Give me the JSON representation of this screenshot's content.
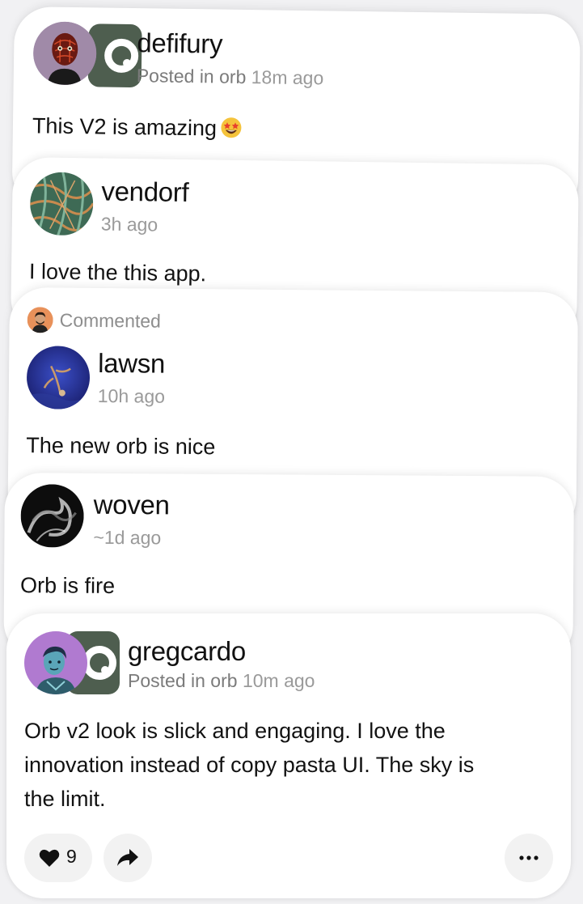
{
  "colors": {
    "card_bg": "#ffffff",
    "page_bg": "#f1f1f3",
    "orb_badge": "#4e5e4f",
    "meta_text": "#9a9a9a",
    "action_bg": "#f2f2f2"
  },
  "posts": [
    {
      "username": "defifury",
      "posted_in_prefix": "Posted in ",
      "community": "orb",
      "time": "18m ago",
      "text": "This V2 is amazing",
      "emoji": "star-struck-emoji",
      "avatar_icon": "avatar-defifury",
      "community_icon": "orb-community-icon"
    },
    {
      "username": "vendorf",
      "time": "3h ago",
      "text": "I love the this app.",
      "avatar_icon": "avatar-vendorf"
    },
    {
      "activity_label": "Commented",
      "username": "lawsn",
      "time": "10h ago",
      "text": "The new orb is nice",
      "avatar_icon": "avatar-lawsn"
    },
    {
      "username": "woven",
      "time": "~1d ago",
      "text": "Orb is fire",
      "avatar_icon": "avatar-woven"
    },
    {
      "username": "gregcardo",
      "posted_in_prefix": "Posted in ",
      "community": "orb",
      "time": "10m ago",
      "text_line1": "Orb v2 look is slick and engaging. I love the",
      "text_line2": "innovation instead of copy pasta UI. The sky is",
      "text_line3": "the limit.",
      "like_count": "9",
      "avatar_icon": "avatar-gregcardo",
      "community_icon": "orb-community-icon"
    }
  ],
  "icons": {
    "like": "heart-icon",
    "share": "share-arrow-icon",
    "more": "more-dots-icon"
  }
}
